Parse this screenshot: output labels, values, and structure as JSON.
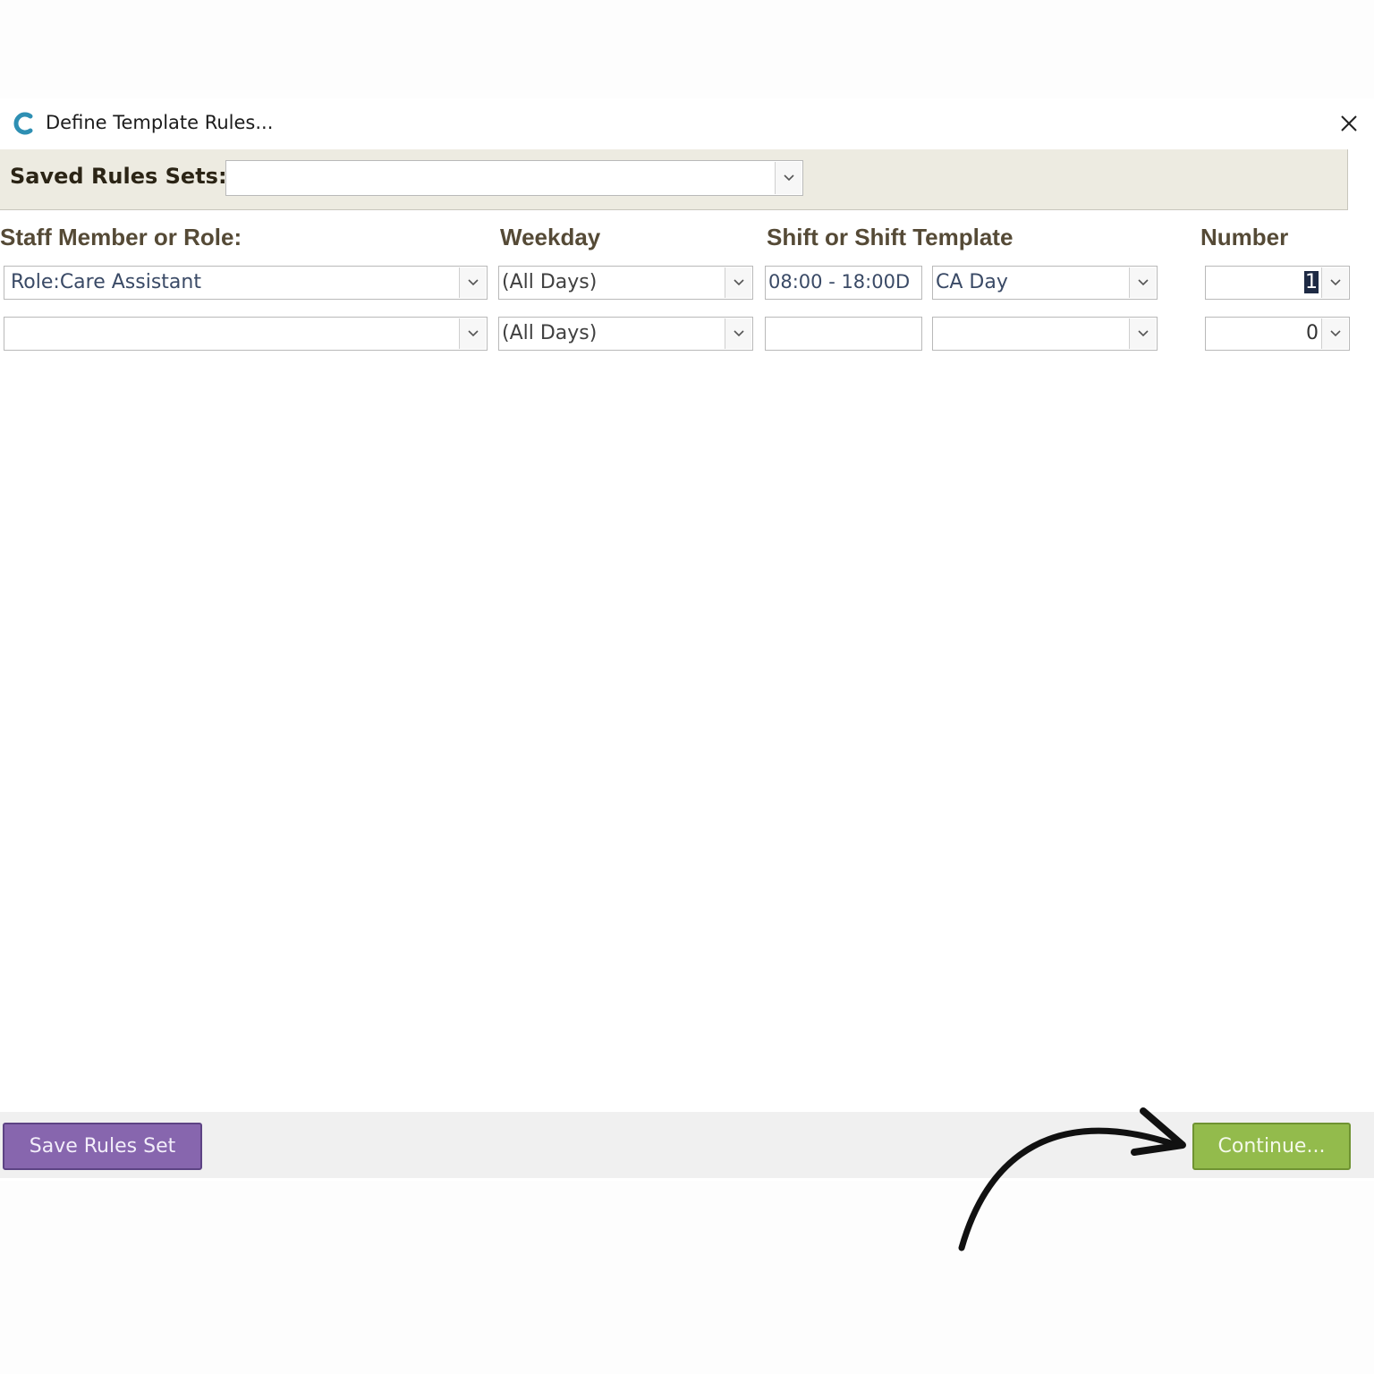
{
  "window": {
    "title": "Define Template Rules...",
    "icon": "app-c-logo-icon",
    "accent_color": "#2e8fb3"
  },
  "saved_rules": {
    "label": "Saved Rules Sets:",
    "value": ""
  },
  "columns": {
    "staff": "Staff Member or Role:",
    "weekday": "Weekday",
    "shift": "Shift or Shift Template",
    "number": "Number"
  },
  "rows": [
    {
      "staff": "Role:Care Assistant",
      "weekday": "(All Days)",
      "shift_time": "08:00 - 18:00D",
      "shift_template": "CA Day",
      "number": "1"
    },
    {
      "staff": "",
      "weekday": "(All Days)",
      "shift_time": "",
      "shift_template": "",
      "number": "0"
    }
  ],
  "footer": {
    "save_label": "Save Rules Set",
    "continue_label": "Continue...",
    "save_color": "#8766ae",
    "continue_color": "#93bb4c"
  }
}
